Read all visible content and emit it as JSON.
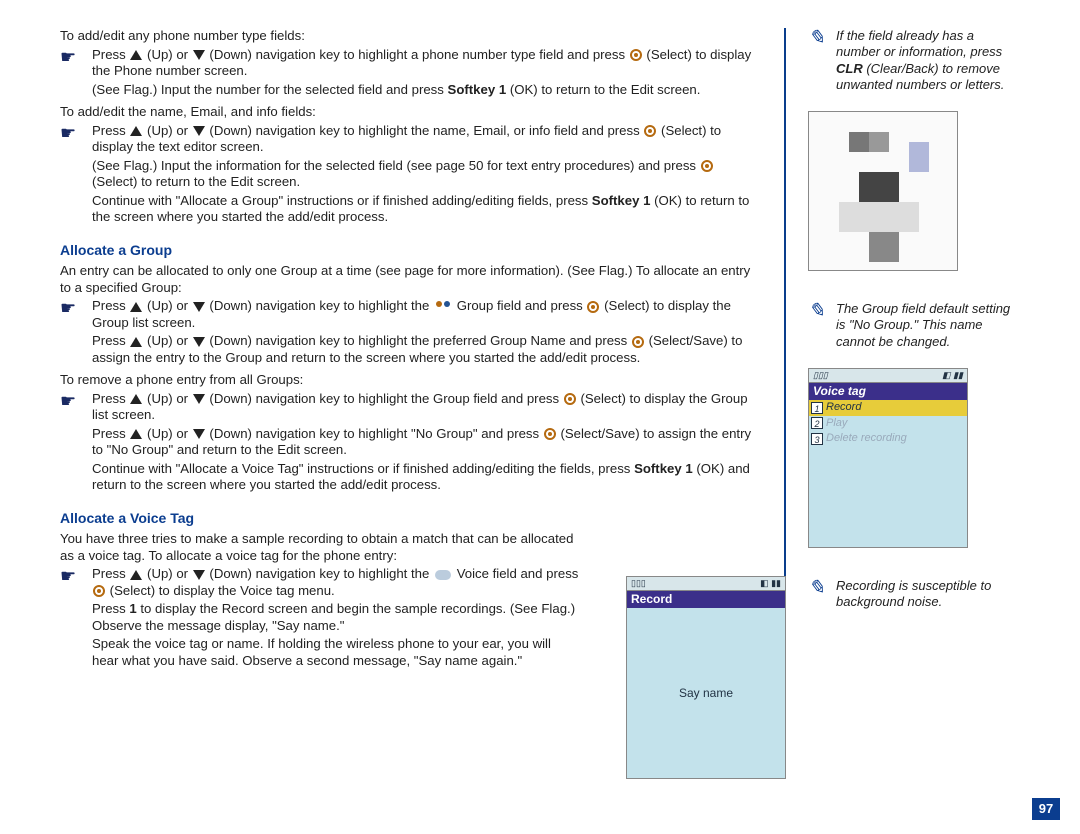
{
  "main": {
    "intro1": "To add/edit any phone number type fields:",
    "b1a": "Press ",
    "b1b": " (Up) or ",
    "b1c": " (Down) navigation key to highlight a phone number type field and press ",
    "b1d": " (Select) to display the Phone number screen.",
    "b1sub": "(See Flag.) Input the number for the selected field and press ",
    "b1sub_bold": "Softkey 1",
    "b1sub2": " (OK) to return to the Edit screen.",
    "intro2": "To add/edit the name, Email, and info fields:",
    "b2a": "Press ",
    "b2b": " (Up) or ",
    "b2c": " (Down) navigation key to highlight the name, Email, or info field and press ",
    "b2d": " (Select) to display the text editor screen.",
    "b2sub_a": "(See Flag.) Input the information for the selected field (see page 50 for text entry procedures) and press ",
    "b2sub_b": " (Select) to return to the Edit screen.",
    "b2cont_a": "Continue with \"Allocate a Group\" instructions or if finished adding/editing fields, press ",
    "b2cont_bold": "Softkey 1",
    "b2cont_b": " (OK) to return to the screen where you started the add/edit process.",
    "h_group": "Allocate a Group",
    "group_intro": "An entry can be allocated to only one Group at a time (see page  for more information). (See Flag.) To allocate an entry to a specified Group:",
    "g1a": "Press ",
    "g1b": " (Up) or ",
    "g1c": " (Down) navigation key to highlight the ",
    "g1d": " Group field and press ",
    "g1e": " (Select) to display the Group list screen.",
    "g1sub_a": "Press ",
    "g1sub_b": " (Up) or ",
    "g1sub_c": " (Down) navigation key to highlight the preferred Group Name and press ",
    "g1sub_d": " (Select/Save) to assign the entry to the Group and return to the screen where you started the add/edit process.",
    "remove_intro": "To remove a phone entry from all Groups:",
    "r1a": "Press ",
    "r1b": " (Up) or ",
    "r1c": " (Down) navigation key to highlight the Group field and press ",
    "r1d": " (Select) to display the Group list screen.",
    "r2a": "Press ",
    "r2b": " (Up) or ",
    "r2c": " (Down) navigation key to highlight \"No Group\" and press ",
    "r2d": " (Select/Save) to assign the entry to \"No Group\" and return to the Edit screen.",
    "r_cont_a": "Continue with \"Allocate a Voice Tag\" instructions or if finished adding/editing the fields, press ",
    "r_cont_bold": "Softkey 1",
    "r_cont_b": " (OK) and return to the screen where you started the add/edit process.",
    "h_voice": "Allocate a Voice Tag",
    "voice_intro": "You have three tries to make a sample recording to obtain a match that can be allocated as a voice tag. To allocate a voice tag for the phone entry:",
    "v1a": "Press ",
    "v1b": " (Up) or ",
    "v1c": " (Down) navigation key to highlight the ",
    "v1d": " Voice field and press ",
    "v1e": " (Select) to display the Voice tag menu.",
    "v2a": "Press ",
    "v2b_bold": "1",
    "v2c": " to display the Record screen and begin the sample recordings. (See Flag.) Observe the message display, \"Say name.\"",
    "v3": "Speak the voice tag or name. If holding the wireless phone to your ear, you will hear what you have said. Observe a second message, \"Say name again.\""
  },
  "side": {
    "note1_a": "If the field already has a number or information, press ",
    "note1_bold": "CLR",
    "note1_b": " (Clear/Back) to remove unwanted numbers or letters.",
    "note2": "The Group field default setting is \"No Group.\" This name cannot be changed.",
    "note3": "Recording is susceptible to background noise."
  },
  "phone_record": {
    "status_l": "▯▯▯",
    "status_r": "◧ ▮▮",
    "title": "Record",
    "body": "Say name"
  },
  "phone_voice": {
    "status_l": "▯▯▯",
    "status_r": "◧ ▮▮",
    "title": "Voice tag",
    "items": [
      {
        "n": "1",
        "t": "Record"
      },
      {
        "n": "2",
        "t": "Play"
      },
      {
        "n": "3",
        "t": "Delete recording"
      }
    ]
  },
  "page_number": "97"
}
